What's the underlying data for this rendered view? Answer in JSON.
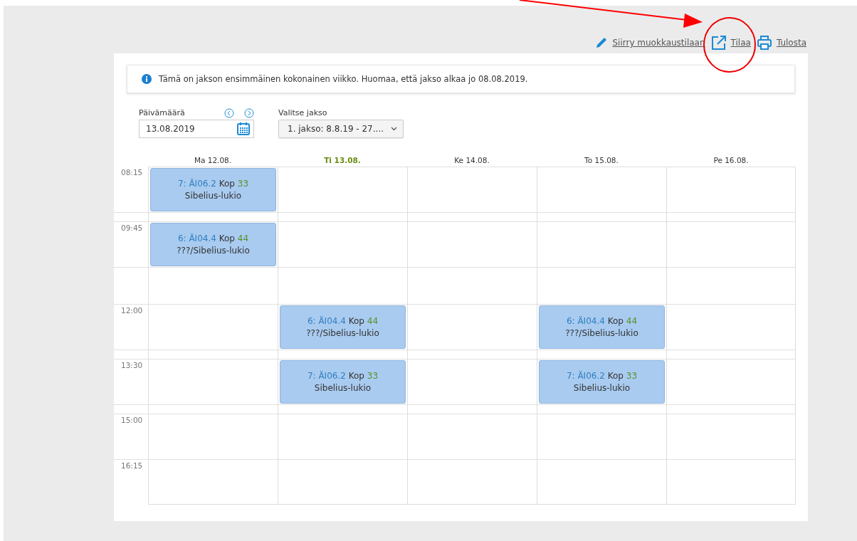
{
  "toolbar": [
    {
      "kind": "edit",
      "label": "Siirry muokkaustilaan"
    },
    {
      "kind": "subscribe",
      "label": "Tilaa"
    },
    {
      "kind": "print",
      "label": "Tulosta"
    }
  ],
  "notice": "Tämä on jakson ensimmäinen kokonainen viikko. Huomaa, että jakso alkaa jo 08.08.2019.",
  "date_field": {
    "label": "Päivämäärä",
    "value": "13.08.2019"
  },
  "period_select": {
    "label": "Valitse jakso",
    "value": "1. jakso: 8.8.19 - 27...."
  },
  "days": [
    {
      "label": "Ma 12.08.",
      "selected": false
    },
    {
      "label": "Ti 13.08.",
      "selected": true
    },
    {
      "label": "Ke 14.08.",
      "selected": false
    },
    {
      "label": "To 15.08.",
      "selected": false
    },
    {
      "label": "Pe 16.08.",
      "selected": false
    }
  ],
  "rows": [
    {
      "kind": "slot",
      "time": "08:15",
      "cells": [
        {
          "course": "7: ÄI06.2",
          "teacher": "Kop",
          "room": "33",
          "place": "Sibelius-lukio"
        },
        {},
        {},
        {},
        {}
      ]
    },
    {
      "kind": "break",
      "cells": [
        {},
        {},
        {},
        {},
        {}
      ]
    },
    {
      "kind": "slot",
      "time": "09:45",
      "cells": [
        {
          "course": "6: ÄI04.4",
          "teacher": "Kop",
          "room": "44",
          "place": "???/Sibelius-lukio"
        },
        {},
        {},
        {},
        {}
      ]
    },
    {
      "kind": "lunch",
      "cells": [
        {},
        {},
        {},
        {},
        {}
      ]
    },
    {
      "kind": "slot",
      "time": "12:00",
      "cells": [
        {},
        {
          "course": "6: ÄI04.4",
          "teacher": "Kop",
          "room": "44",
          "place": "???/Sibelius-lukio"
        },
        {},
        {
          "course": "6: ÄI04.4",
          "teacher": "Kop",
          "room": "44",
          "place": "???/Sibelius-lukio"
        },
        {}
      ]
    },
    {
      "kind": "break",
      "cells": [
        {},
        {},
        {},
        {},
        {}
      ]
    },
    {
      "kind": "slot",
      "time": "13:30",
      "cells": [
        {},
        {
          "course": "7: ÄI06.2",
          "teacher": "Kop",
          "room": "33",
          "place": "Sibelius-lukio"
        },
        {},
        {
          "course": "7: ÄI06.2",
          "teacher": "Kop",
          "room": "33",
          "place": "Sibelius-lukio"
        },
        {}
      ]
    },
    {
      "kind": "break",
      "cells": [
        {},
        {},
        {},
        {},
        {}
      ]
    },
    {
      "kind": "slot",
      "time": "15:00",
      "cells": [
        {},
        {},
        {},
        {},
        {}
      ]
    },
    {
      "kind": "slot",
      "time": "16:15",
      "cells": [
        {},
        {},
        {},
        {},
        {}
      ]
    }
  ]
}
